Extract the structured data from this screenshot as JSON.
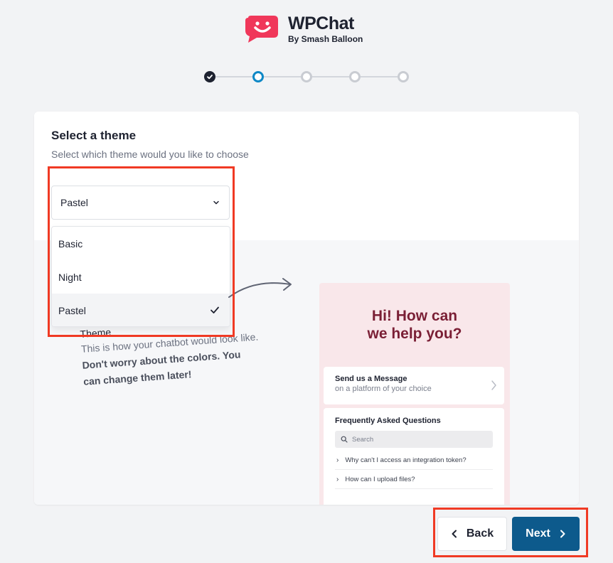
{
  "brand": {
    "name": "WPChat",
    "by": "By Smash Balloon",
    "logo_color": "#f0375a"
  },
  "stepper": {
    "steps": [
      "done",
      "active",
      "pending",
      "pending",
      "pending"
    ],
    "current_step": 2,
    "accent": "#0e88c6"
  },
  "card": {
    "title": "Select a theme",
    "subtitle": "Select which theme would you like to choose"
  },
  "theme_select": {
    "value": "Pastel",
    "options": [
      {
        "label": "Basic",
        "selected": false
      },
      {
        "label": "Night",
        "selected": false
      },
      {
        "label": "Pastel",
        "selected": true
      }
    ]
  },
  "theme_note": {
    "title": "Theme",
    "body": "This is how your chatbot would look like.",
    "emphasis_1": "Don't worry about the colors.",
    "emphasis_2": "You can change them later!"
  },
  "preview": {
    "greeting_1": "Hi! How can",
    "greeting_2": "we help you?",
    "greeting_color": "#7a1f35",
    "background": "#f9e7ea",
    "message_card": {
      "title": "Send us a Message",
      "subtitle": "on a platform of your choice"
    },
    "faq": {
      "title": "Frequently Asked Questions",
      "search_placeholder": "Search",
      "items": [
        "Why can't I access an integration token?",
        "How can I upload files?"
      ]
    }
  },
  "actions": {
    "back_label": "Back",
    "next_label": "Next",
    "next_color": "#0d5a8c"
  },
  "highlight_color": "#f03a24"
}
